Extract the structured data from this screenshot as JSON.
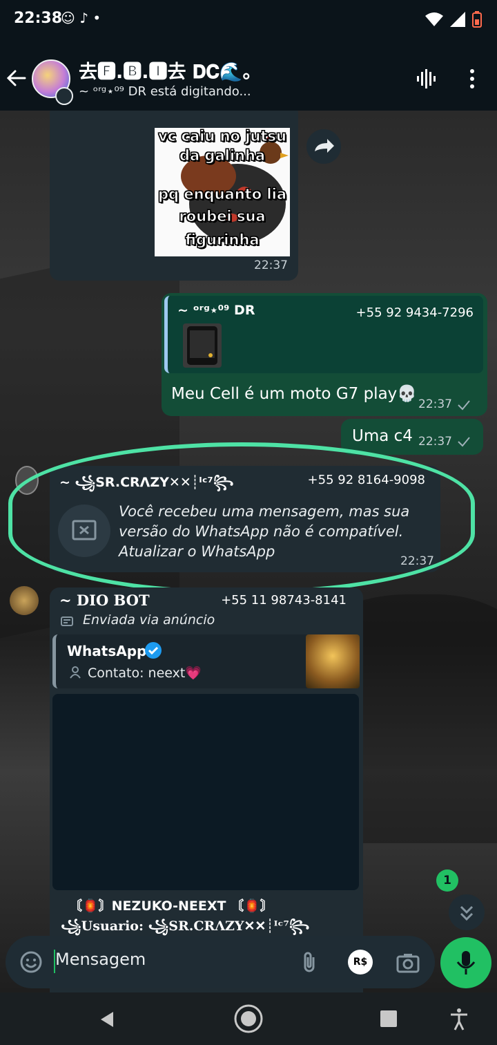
{
  "status_bar": {
    "time": "22:38",
    "left_icons": "☺ ♪ •"
  },
  "header": {
    "title": "去🅵.🅱.🅸去 𝐃𝐂🌊。",
    "subtitle": "~ ᵒʳᵍ⋆⁰⁹ DR está digitando..."
  },
  "messages": {
    "sticker": {
      "lines": [
        "vc caiu no jutsu",
        "da galinha",
        "pq enquanto lia",
        "roubei sua",
        "figurinha"
      ],
      "time": "22:37"
    },
    "reply": {
      "quoted_name": "~ ᵒʳᵍ⋆⁰⁹ DR",
      "quoted_phone": "+55 92 9434-7296",
      "text": "Meu Cell é um moto G7 play💀",
      "time": "22:37"
    },
    "short": {
      "text": "Uma c4",
      "time": "22:37"
    },
    "unsupported": {
      "sender": "~ ꧁SR.CRΛZY✕✕┊ᴵᶜ⁷꧂",
      "phone": "+55 92 8164-9098",
      "text": "Você recebeu uma mensagem, mas sua versão do WhatsApp não é compatível. Atualizar o WhatsApp",
      "time": "22:37"
    },
    "dio": {
      "sender": "~ DIO BOT",
      "phone": "+55 11 98743-8141",
      "ad_label": "Enviada via anúncio",
      "card_title": "WhatsApp",
      "card_contact": "Contato: neext💗",
      "footer1": "〘🏮〙NEZUKO-NEEXT 〘🏮〙",
      "footer2": "꧁Usuario: ꧁SR.CRΛZY✕✕┊ᴵᶜ⁷꧂"
    }
  },
  "composer": {
    "placeholder": "Mensagem",
    "pay_label": "R$"
  },
  "unread_count": "1",
  "colors": {
    "accent": "#21c063",
    "highlight": "#4ee2a5",
    "bubble_in": "#202c33",
    "bubble_out": "#005c4b"
  }
}
